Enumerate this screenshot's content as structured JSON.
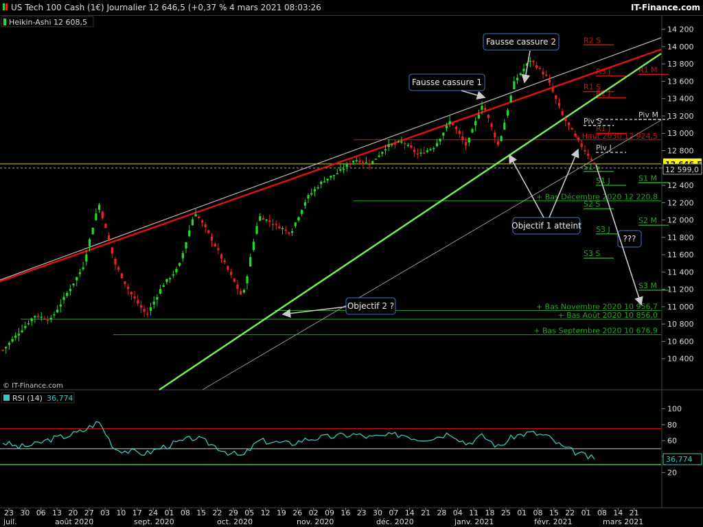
{
  "header": {
    "title": "US Tech 100 Cash (1€) Journalier 12 646,5 (+0,37 % 4 mars 2021 08:03:26",
    "site": "IT-Finance.com",
    "series_label": "Heikin-Ashi 12 608,5",
    "watermark": "© IT-Finance.com",
    "rsi_label": "RSI (14)",
    "rsi_value": "36,774"
  },
  "colors": {
    "background": "#000000",
    "bull": "#22dd22",
    "bear": "#ee2222",
    "resistance": "#dd1111",
    "support": "#77ee55",
    "rsi_line": "#33ccbb"
  },
  "chart_data": [
    {
      "type": "line",
      "title": "US Tech 100 Cash (1€) Journalier",
      "series_name": "Heikin-Ashi",
      "x_dates": [
        "2020-06-23",
        "2020-06-30",
        "2020-07-06",
        "2020-07-13",
        "2020-07-20",
        "2020-07-27",
        "2020-08-03",
        "2020-08-10",
        "2020-08-17",
        "2020-08-24",
        "2020-09-01",
        "2020-09-08",
        "2020-09-15",
        "2020-09-22",
        "2020-09-29",
        "2020-10-05",
        "2020-10-12",
        "2020-10-19",
        "2020-10-26",
        "2020-11-02",
        "2020-11-09",
        "2020-11-16",
        "2020-11-23",
        "2020-11-30",
        "2020-12-07",
        "2020-12-14",
        "2020-12-21",
        "2020-12-28",
        "2021-01-04",
        "2021-01-11",
        "2021-01-18",
        "2021-01-25",
        "2021-02-01",
        "2021-02-08",
        "2021-02-15",
        "2021-02-22",
        "2021-03-01",
        "2021-03-04"
      ],
      "close_values": [
        10500,
        10700,
        10900,
        10850,
        11150,
        11450,
        12200,
        11500,
        11150,
        10900,
        11250,
        11450,
        12100,
        11800,
        11450,
        11100,
        12050,
        11950,
        11850,
        12250,
        12450,
        12550,
        12700,
        12650,
        12850,
        12900,
        12750,
        12850,
        13150,
        12850,
        13350,
        12850,
        13600,
        13850,
        13650,
        13200,
        12900,
        12646.5
      ],
      "x_tick_labels": [
        "23",
        "30",
        "06",
        "13",
        "20",
        "27",
        "03",
        "10",
        "17",
        "24",
        "01",
        "08",
        "15",
        "22",
        "29",
        "05",
        "12",
        "19",
        "26",
        "02",
        "09",
        "16",
        "23",
        "30",
        "07",
        "14",
        "21",
        "28",
        "04",
        "11",
        "18",
        "25",
        "01",
        "08",
        "15",
        "22",
        "01",
        "08",
        "14",
        "21"
      ],
      "month_labels": [
        "juil.",
        "août 2020",
        "sept. 2020",
        "oct. 2020",
        "nov. 2020",
        "déc. 2020",
        "janv. 2021",
        "févr. 2021",
        "mars 2021"
      ],
      "y_tick_labels": [
        "14 200",
        "14 000",
        "13 800",
        "13 600",
        "13 400",
        "13 200",
        "13 000",
        "12 800",
        "12 600",
        "12 400",
        "12 200",
        "12 000",
        "11 800",
        "11 600",
        "11 400",
        "11 200",
        "11 000",
        "10 800",
        "10 600",
        "10 400"
      ],
      "ylim": [
        10200,
        14300
      ],
      "last_price": "12 646,5",
      "last_ha": "12 599,0",
      "price_value": 12646.5,
      "ha_value": 12599.0,
      "horizontal_levels": [
        {
          "label": "R2 S",
          "value": 14020,
          "color": "#dd1111"
        },
        {
          "label": "R3 J",
          "value": 13660,
          "color": "#dd1111"
        },
        {
          "label": "R1 M",
          "value": 13680,
          "color": "#dd1111"
        },
        {
          "label": "R1 S",
          "value": 13480,
          "color": "#dd1111"
        },
        {
          "label": "R2 J",
          "value": 13410,
          "color": "#dd1111"
        },
        {
          "label": "Piv M",
          "value": 13160,
          "color": "#cccccc"
        },
        {
          "label": "Piv S",
          "value": 13090,
          "color": "#cccccc"
        },
        {
          "label": "R1 J",
          "value": 13000,
          "color": "#dd1111"
        },
        {
          "label": "+ Haut 2030 12 924,5",
          "value": 12924.5,
          "color": "#dd1111"
        },
        {
          "label": "Piv J",
          "value": 12780,
          "color": "#cccccc"
        },
        {
          "label": "S1 S",
          "value": 12560,
          "color": "#22aa22"
        },
        {
          "label": "S1 J",
          "value": 12400,
          "color": "#22aa22"
        },
        {
          "label": "S1 M",
          "value": 12430,
          "color": "#22aa22"
        },
        {
          "label": "+ Bas Décembre 2020 12 220,8",
          "value": 12220.8,
          "color": "#22aa22"
        },
        {
          "label": "S2 S",
          "value": 12130,
          "color": "#22aa22"
        },
        {
          "label": "S2 M",
          "value": 11940,
          "color": "#22aa22"
        },
        {
          "label": "S3 J",
          "value": 11840,
          "color": "#22aa22"
        },
        {
          "label": "S3 S",
          "value": 11560,
          "color": "#22aa22"
        },
        {
          "label": "S3 M",
          "value": 11190,
          "color": "#22aa22"
        },
        {
          "label": "+ Bas Novembre 2020 10 956,7",
          "value": 10956.7,
          "color": "#22aa22"
        },
        {
          "label": "+ Bas Août 2020 10 856,0",
          "value": 10856.0,
          "color": "#22aa22"
        },
        {
          "label": "+ Bas Septembre 2020 10 676,9",
          "value": 10676.9,
          "color": "#22aa22"
        }
      ],
      "annotations": [
        "Fausse cassure 1",
        "Fausse cassure 2",
        "Objectif 1 atteint",
        "Objectif 2 ?",
        "???"
      ]
    },
    {
      "type": "line",
      "title": "RSI (14)",
      "ylim": [
        0,
        110
      ],
      "y_tick_labels": [
        "100",
        "80",
        "60",
        "40",
        "20"
      ],
      "overbought": 75,
      "oversold": 30,
      "mid": 50,
      "values": [
        58,
        52,
        55,
        62,
        66,
        72,
        84,
        50,
        46,
        44,
        52,
        58,
        64,
        56,
        46,
        40,
        60,
        58,
        56,
        62,
        64,
        66,
        68,
        64,
        66,
        68,
        62,
        64,
        70,
        56,
        66,
        52,
        66,
        70,
        66,
        52,
        44,
        36.774
      ],
      "last_value": "36,774"
    }
  ]
}
